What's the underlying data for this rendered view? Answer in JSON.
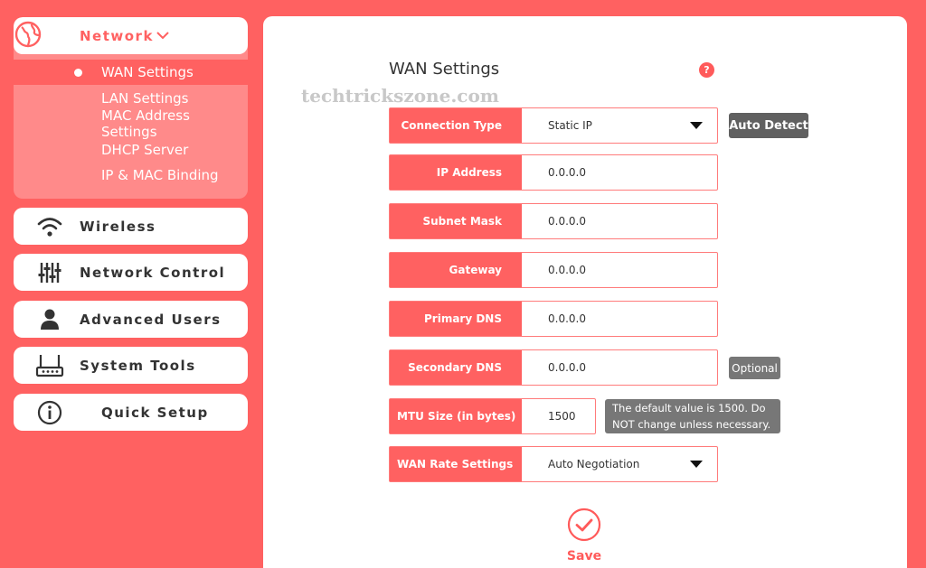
{
  "colors": {
    "accent": "#FF6161",
    "submenu_bg": "#FF8A8A",
    "panel": "#FFFFFF",
    "text": "#333333",
    "badge": "#606060"
  },
  "sidebar": {
    "network": {
      "label": "Network",
      "icon": "globe-icon",
      "items": [
        {
          "label": "WAN Settings",
          "active": true
        },
        {
          "label": "LAN Settings"
        },
        {
          "label": "MAC Address Settings"
        },
        {
          "label": "DHCP Server"
        },
        {
          "label": "IP & MAC Binding"
        }
      ]
    },
    "menu": [
      {
        "label": "Wireless",
        "icon": "wifi-icon"
      },
      {
        "label": "Network Control",
        "icon": "sliders-icon"
      },
      {
        "label": "Advanced Users",
        "icon": "user-icon"
      },
      {
        "label": "System Tools",
        "icon": "router-icon"
      },
      {
        "label": "Quick Setup",
        "icon": "info-icon"
      }
    ]
  },
  "main": {
    "title": "WAN Settings",
    "help": "?",
    "watermark": "techtrickszone.com",
    "fields": {
      "connection_type": {
        "label": "Connection Type",
        "value": "Static IP"
      },
      "ip_address": {
        "label": "IP Address",
        "value": "0.0.0.0"
      },
      "subnet_mask": {
        "label": "Subnet Mask",
        "value": "0.0.0.0"
      },
      "gateway": {
        "label": "Gateway",
        "value": "0.0.0.0"
      },
      "primary_dns": {
        "label": "Primary DNS",
        "value": "0.0.0.0"
      },
      "secondary_dns": {
        "label": "Secondary DNS",
        "value": "0.0.0.0"
      },
      "mtu_size": {
        "label": "MTU Size (in bytes)",
        "value": "1500"
      },
      "wan_rate": {
        "label": "WAN Rate Settings",
        "value": "Auto Negotiation"
      }
    },
    "auto_detect_label": "Auto Detect",
    "optional_label": "Optional",
    "mtu_tip": "The default value is 1500. Do NOT change unless necessary.",
    "save_label": "Save"
  }
}
